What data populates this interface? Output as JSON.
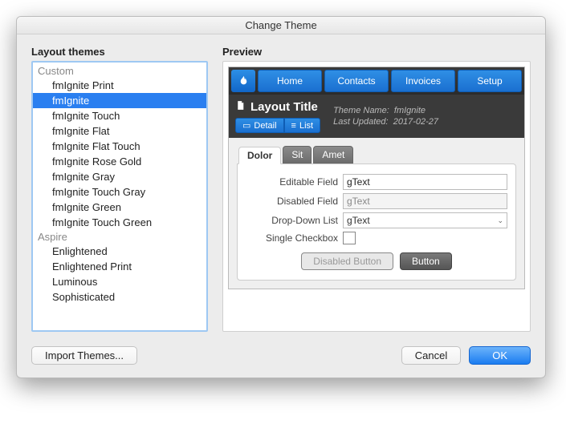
{
  "window": {
    "title": "Change Theme"
  },
  "left": {
    "heading": "Layout themes",
    "groups": [
      {
        "label": "Custom",
        "items": [
          "fmIgnite Print",
          "fmIgnite",
          "fmIgnite Touch",
          "fmIgnite Flat",
          "fmIgnite Flat Touch",
          "fmIgnite Rose Gold",
          "fmIgnite Gray",
          "fmIgnite Touch Gray",
          "fmIgnite Green",
          "fmIgnite Touch Green"
        ],
        "selected_index": 1
      },
      {
        "label": "Aspire",
        "items": [
          "Enlightened",
          "Enlightened Print",
          "Luminous",
          "Sophisticated"
        ],
        "selected_index": -1
      }
    ]
  },
  "preview": {
    "heading": "Preview",
    "nav": [
      "Home",
      "Contacts",
      "Invoices",
      "Setup"
    ],
    "title": "Layout Title",
    "view_tabs": {
      "detail": "Detail",
      "list": "List"
    },
    "meta": {
      "line1_label": "Theme Name:",
      "line1_value": "fmIgnite",
      "line2_label": "Last Updated:",
      "line2_value": "2017-02-27"
    },
    "inner_tabs": [
      "Dolor",
      "Sit",
      "Amet"
    ],
    "inner_active": 0,
    "fields": {
      "editable_label": "Editable Field",
      "editable_value": "gText",
      "disabled_label": "Disabled Field",
      "disabled_value": "gText",
      "dropdown_label": "Drop-Down List",
      "dropdown_value": "gText",
      "checkbox_label": "Single Checkbox"
    },
    "buttons": {
      "disabled": "Disabled Button",
      "primary": "Button"
    }
  },
  "footer": {
    "import": "Import Themes...",
    "cancel": "Cancel",
    "ok": "OK"
  }
}
